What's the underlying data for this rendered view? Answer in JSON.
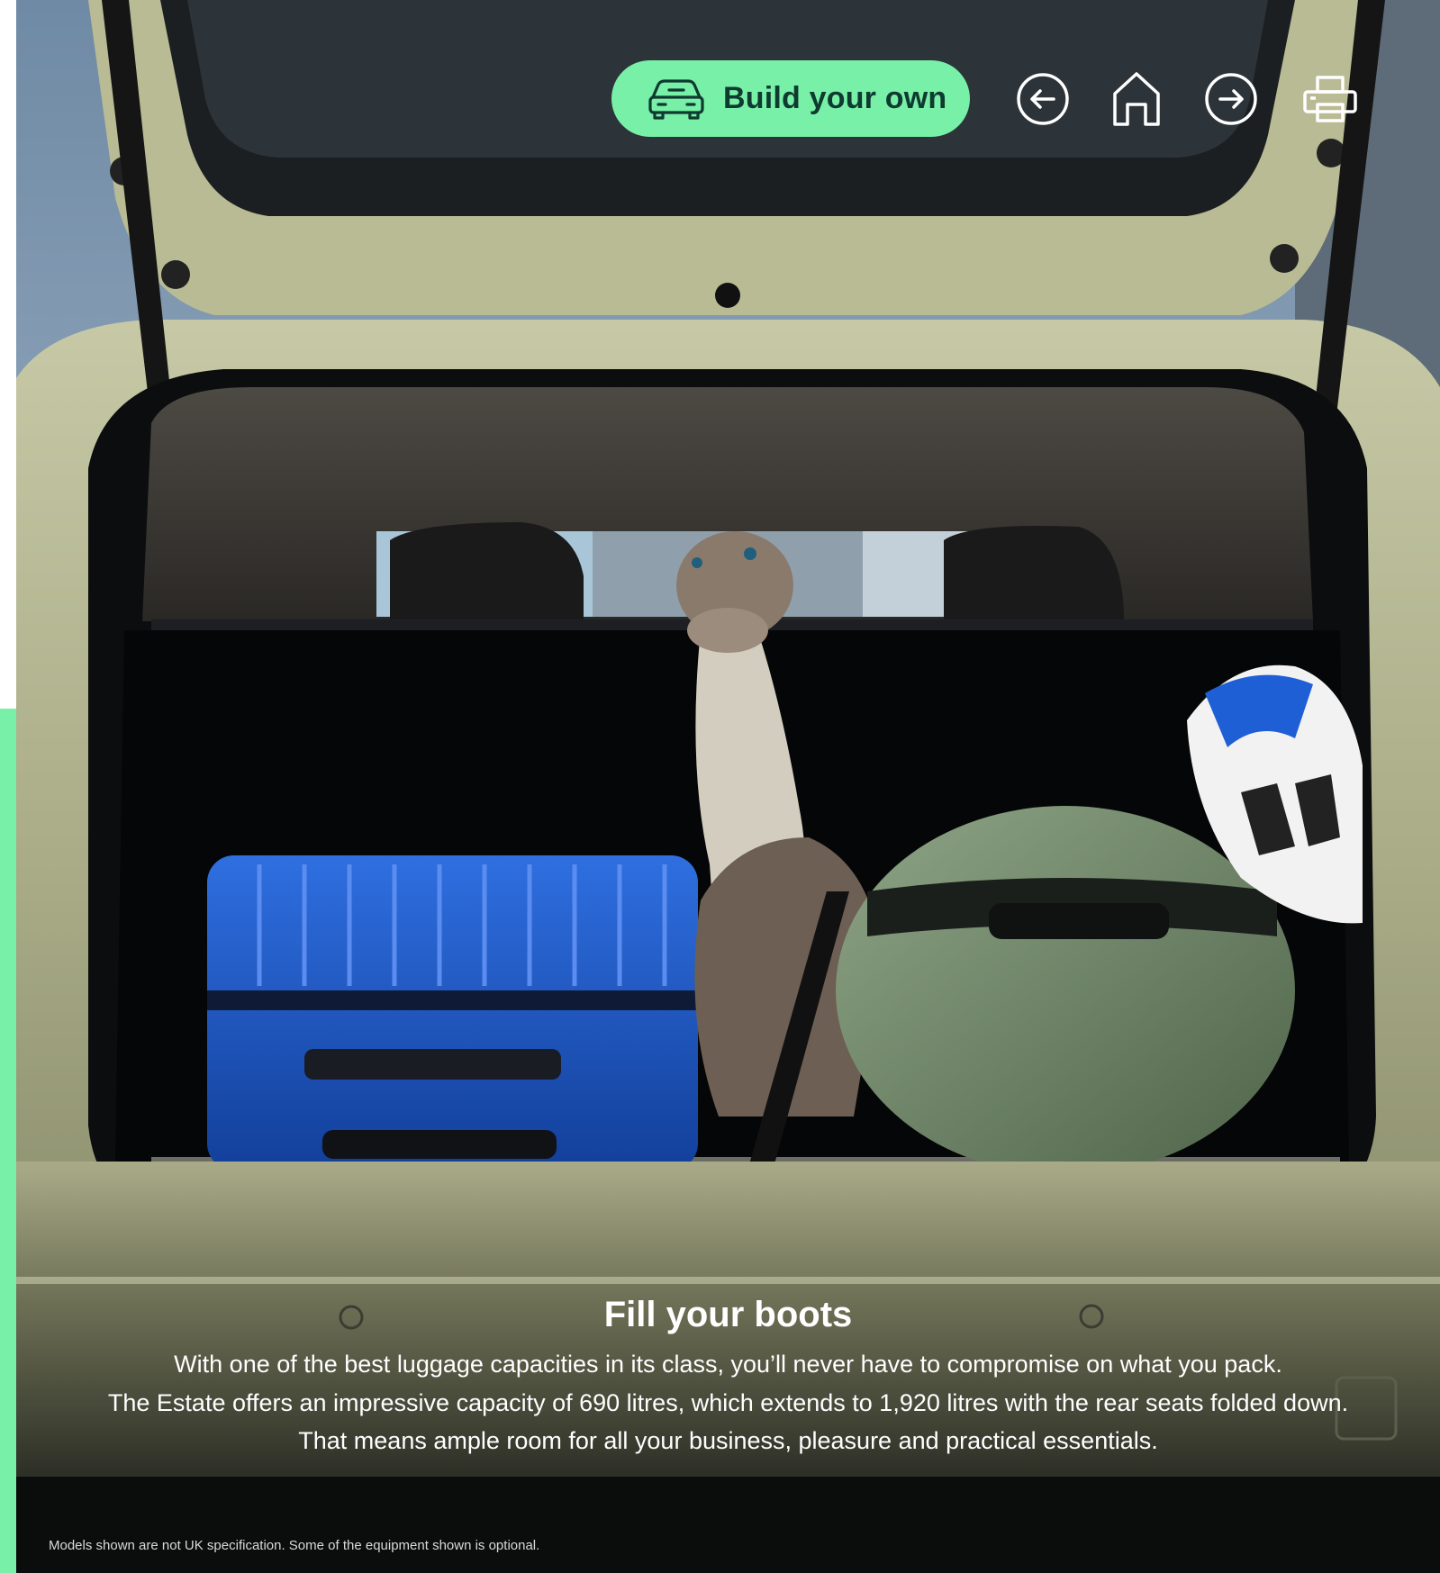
{
  "header": {
    "build_button": {
      "label": "Build your own",
      "icon": "car-icon"
    },
    "nav_icons": [
      "arrow-left-circle-icon",
      "home-icon",
      "arrow-right-circle-icon",
      "printer-icon"
    ]
  },
  "caption": {
    "title": "Fill your boots",
    "lines": [
      "With one of the best luggage capacities in its class, you’ll never have to compromise on what you pack.",
      "The Estate offers an impressive capacity of 690 litres, which extends to 1,920 litres with the rear seats folded down.",
      "That means ample room for all your business, pleasure and practical essentials."
    ]
  },
  "footnote": "Models shown are not UK specification. Some of the equipment shown is optional.",
  "colors": {
    "accent": "#78f0a8",
    "accent_text": "#0e3a2f",
    "car_body": "#a7aa83"
  }
}
